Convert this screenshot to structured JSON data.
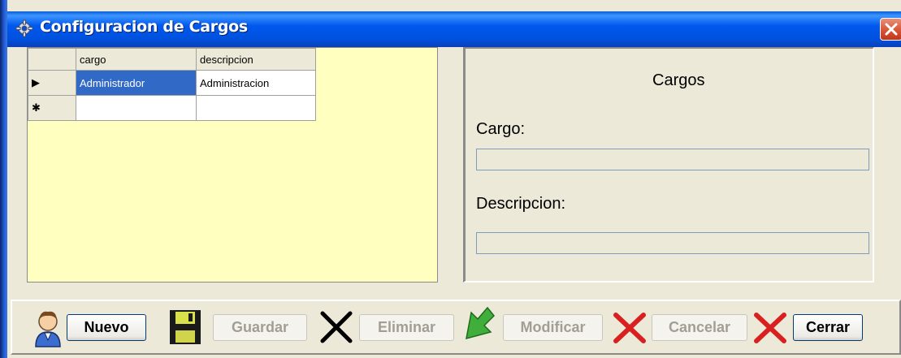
{
  "window": {
    "title": "Configuracion de Cargos"
  },
  "grid": {
    "columns": [
      "cargo",
      "descripcion"
    ],
    "rows": [
      {
        "marker": "▶",
        "cargo": "Administrador",
        "descripcion": "Administracion"
      },
      {
        "marker": "✱",
        "cargo": "",
        "descripcion": ""
      }
    ]
  },
  "form": {
    "title": "Cargos",
    "cargo_label": "Cargo:",
    "cargo_value": "",
    "descripcion_label": "Descripcion:",
    "descripcion_value": ""
  },
  "toolbar": {
    "nuevo": "Nuevo",
    "guardar": "Guardar",
    "eliminar": "Eliminar",
    "modificar": "Modificar",
    "cancelar": "Cancelar",
    "cerrar": "Cerrar"
  }
}
